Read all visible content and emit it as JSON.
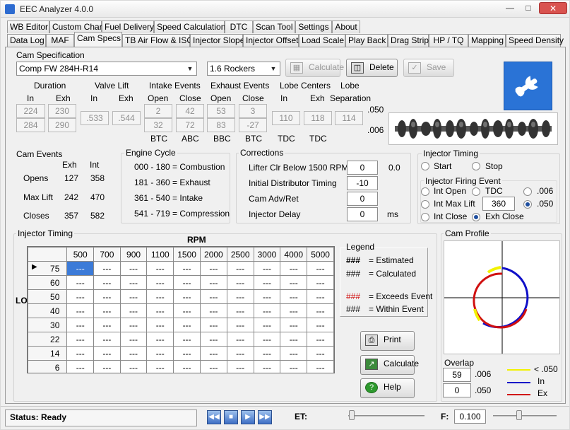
{
  "app": {
    "title": "EEC Analyzer 4.0.0"
  },
  "tabs_row1": [
    "WB Editor",
    "Custom Chart",
    "Fuel Delivery",
    "Speed Calculation",
    "DTC",
    "Scan Tool",
    "Settings",
    "About"
  ],
  "tabs_row2": [
    "Data Log",
    "MAF",
    "Cam Specs",
    "TB Air Flow & ISC",
    "Injector Slope",
    "Injector Offset",
    "Load Scale",
    "Play Back",
    "Drag Strip",
    "HP / TQ",
    "Mapping",
    "Speed Density"
  ],
  "cam_spec": {
    "label": "Cam Specification",
    "cam": "Comp FW 284H-R14",
    "rockers": "1.6 Rockers",
    "calc_label": "Calculate",
    "delete_label": "Delete",
    "save_label": "Save"
  },
  "headers": {
    "duration": "Duration",
    "valve_lift": "Valve Lift",
    "intake_events": "Intake Events",
    "exhaust_events": "Exhaust Events",
    "lobe_centers": "Lobe Centers",
    "lobe": "Lobe",
    "in": "In",
    "exh": "Exh",
    "open": "Open",
    "close": "Close",
    "separation": "Separation"
  },
  "specs": {
    "dur_in_050": "224",
    "dur_exh_050": "230",
    "dur_in_006": "284",
    "dur_exh_006": "290",
    "lift_in": ".533",
    "lift_exh": ".544",
    "int_open_050": "2",
    "int_close_050": "42",
    "int_open_006": "32",
    "int_close_006": "72",
    "exh_open_050": "53",
    "exh_close_050": "3",
    "exh_open_006": "83",
    "exh_close_006": "-27",
    "lc_in": "110",
    "lc_exh": "118",
    "sep": "114",
    "row050": ".050",
    "row006": ".006",
    "btc1": "BTC",
    "abc": "ABC",
    "bbc": "BBC",
    "btc2": "BTC",
    "tdc1": "TDC",
    "tdc2": "TDC"
  },
  "cam_events": {
    "title": "Cam Events",
    "exh": "Exh",
    "int": "Int",
    "rows": [
      {
        "label": "Opens",
        "exh": "127",
        "int": "358"
      },
      {
        "label": "Max Lift",
        "exh": "242",
        "int": "470"
      },
      {
        "label": "Closes",
        "exh": "357",
        "int": "582"
      }
    ]
  },
  "engine_cycle": {
    "title": "Engine Cycle",
    "rows": [
      "000 - 180 = Combustion",
      "181 - 360 = Exhaust",
      "361 - 540 = Intake",
      "541 - 719 = Compression"
    ]
  },
  "corrections": {
    "title": "Corrections",
    "lifter_label": "Lifter Clr Below 1500 RPM",
    "lifter_val": "0",
    "lifter_out": "0.0",
    "dist_label": "Initial Distributor Timing",
    "dist_val": "-10",
    "adv_label": "Cam Adv/Ret",
    "adv_val": "0",
    "delay_label": "Injector Delay",
    "delay_val": "0",
    "delay_unit": "ms"
  },
  "inj_timing_top": {
    "title": "Injector  Timing",
    "start": "Start",
    "stop": "Stop"
  },
  "firing": {
    "title": "Injector Firing Event",
    "int_open": "Int Open",
    "tdc": "TDC",
    "int_max": "Int Max Lift",
    "int_max_val": "360",
    "int_close": "Int Close",
    "exh_close": "Exh Close",
    "v006": ".006",
    "v050": ".050"
  },
  "injector_table": {
    "title": "Injector Timing",
    "rpm_label": "RPM",
    "load_label": "LOAD",
    "rpm": [
      "500",
      "700",
      "900",
      "1100",
      "1500",
      "2000",
      "2500",
      "3000",
      "4000",
      "5000"
    ],
    "load": [
      "75",
      "60",
      "50",
      "40",
      "30",
      "22",
      "14",
      "6"
    ],
    "cell": "---"
  },
  "legend": {
    "title": "Legend",
    "estimated": "### = Estimated",
    "calculated": "### = Calculated",
    "exceeds": "### = Exceeds Event",
    "within": "### = Within Event",
    "hash": "###",
    "est_txt": "= Estimated",
    "calc_txt": "= Calculated",
    "exc_txt": "= Exceeds Event",
    "within_txt": "= Within Event"
  },
  "actions": {
    "print": "Print",
    "calculate": "Calculate",
    "help": "Help"
  },
  "cam_profile": {
    "title": "Cam Profile"
  },
  "overlap": {
    "title": "Overlap",
    "v1": "59",
    "u1": ".006",
    "v2": "0",
    "u2": ".050",
    "key1": "< .050",
    "key2": "In",
    "key3": "Ex"
  },
  "status": {
    "text": "Status: Ready",
    "et_label": "ET:",
    "f_label": "F:",
    "f_val": "0.100"
  },
  "colors": {
    "intake": "#1010c8",
    "exhaust": "#d01010",
    "lt050": "#f2f200",
    "accent": "#3c7bd8"
  }
}
